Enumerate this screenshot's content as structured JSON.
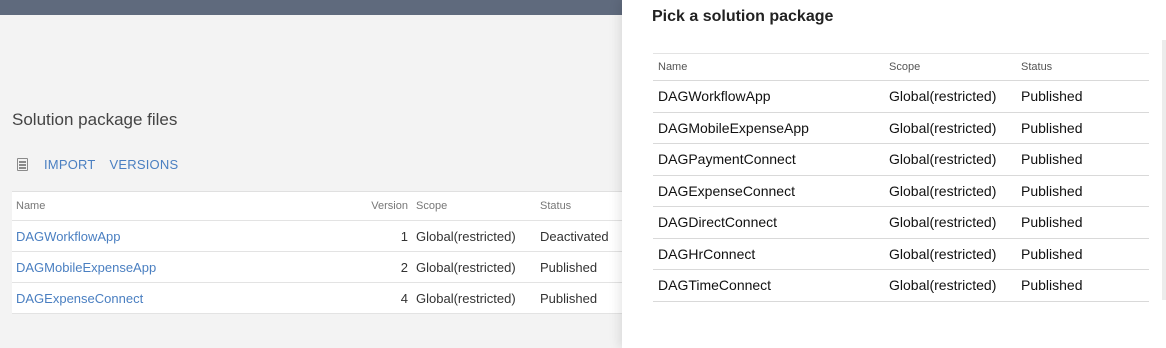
{
  "background": {
    "title": "Solution package files",
    "toolbar": {
      "import_label": "IMPORT",
      "versions_label": "VERSIONS"
    },
    "table": {
      "headers": {
        "name": "Name",
        "version": "Version",
        "scope": "Scope",
        "status": "Status"
      },
      "rows": [
        {
          "name": "DAGWorkflowApp",
          "version": "1",
          "scope": "Global(restricted)",
          "status": "Deactivated"
        },
        {
          "name": "DAGMobileExpenseApp",
          "version": "2",
          "scope": "Global(restricted)",
          "status": "Published"
        },
        {
          "name": "DAGExpenseConnect",
          "version": "4",
          "scope": "Global(restricted)",
          "status": "Published"
        }
      ]
    }
  },
  "panel": {
    "title": "Pick a solution package",
    "headers": {
      "name": "Name",
      "scope": "Scope",
      "status": "Status"
    },
    "rows": [
      {
        "name": "DAGWorkflowApp",
        "scope": "Global(restricted)",
        "status": "Published"
      },
      {
        "name": "DAGMobileExpenseApp",
        "scope": "Global(restricted)",
        "status": "Published"
      },
      {
        "name": "DAGPaymentConnect",
        "scope": "Global(restricted)",
        "status": "Published"
      },
      {
        "name": "DAGExpenseConnect",
        "scope": "Global(restricted)",
        "status": "Published"
      },
      {
        "name": "DAGDirectConnect",
        "scope": "Global(restricted)",
        "status": "Published"
      },
      {
        "name": "DAGHrConnect",
        "scope": "Global(restricted)",
        "status": "Published"
      },
      {
        "name": "DAGTimeConnect",
        "scope": "Global(restricted)",
        "status": "Published"
      }
    ]
  }
}
